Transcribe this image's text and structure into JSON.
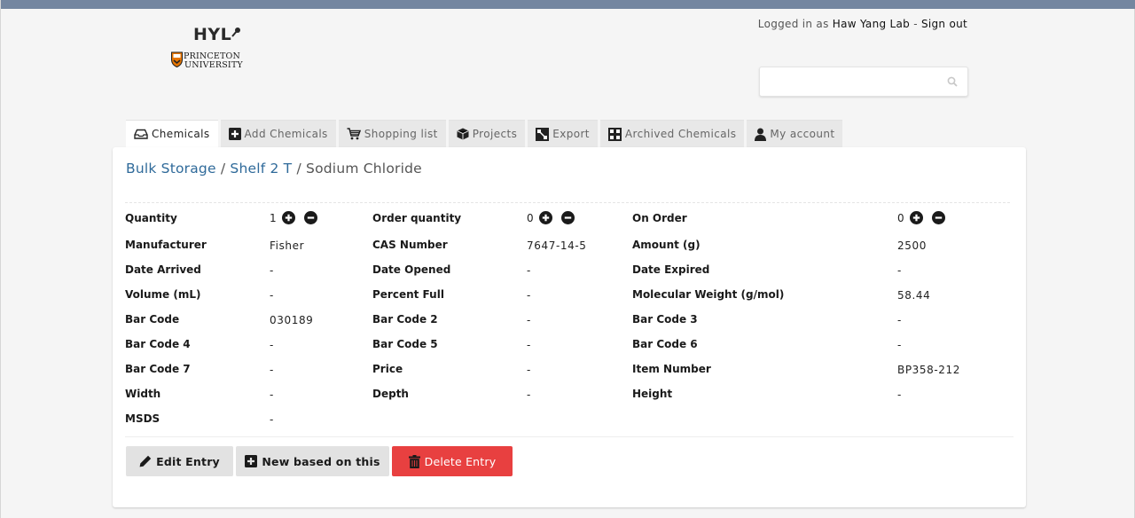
{
  "header": {
    "logo_text": "HYL",
    "institution_line1": "PRINCETON",
    "institution_line2": "UNIVERSITY",
    "logged_in_prefix": "Logged in as ",
    "user_name": "Haw Yang Lab",
    "separator": " - ",
    "sign_out": "Sign out",
    "search_placeholder": ""
  },
  "tabs": [
    {
      "label": "Chemicals",
      "icon": "inbox-icon",
      "active": true
    },
    {
      "label": "Add Chemicals",
      "icon": "plus-square-icon",
      "active": false
    },
    {
      "label": "Shopping list",
      "icon": "cart-icon",
      "active": false
    },
    {
      "label": "Projects",
      "icon": "cube-icon",
      "active": false
    },
    {
      "label": "Export",
      "icon": "export-icon",
      "active": false
    },
    {
      "label": "Archived Chemicals",
      "icon": "sitemap-icon",
      "active": false
    },
    {
      "label": "My account",
      "icon": "user-icon",
      "active": false
    }
  ],
  "breadcrumb": {
    "storage": "Bulk Storage",
    "sep1": " / ",
    "shelf": "Shelf 2 T",
    "sep2": " / ",
    "current": "Sodium Chloride"
  },
  "fields": {
    "col1": [
      {
        "label": "Quantity",
        "value": "1",
        "stepper": true
      },
      {
        "label": "Manufacturer",
        "value": "Fisher"
      },
      {
        "label": "Date Arrived",
        "value": "-"
      },
      {
        "label": "Volume (mL)",
        "value": "-"
      },
      {
        "label": "Bar Code",
        "value": "030189"
      },
      {
        "label": "Bar Code 4",
        "value": "-"
      },
      {
        "label": "Bar Code 7",
        "value": "-"
      },
      {
        "label": "Width",
        "value": "-"
      },
      {
        "label": "MSDS",
        "value": "-"
      }
    ],
    "col2": [
      {
        "label": "Order quantity",
        "value": "0",
        "stepper": true
      },
      {
        "label": "CAS Number",
        "value": "7647-14-5"
      },
      {
        "label": "Date Opened",
        "value": "-"
      },
      {
        "label": "Percent Full",
        "value": "-"
      },
      {
        "label": "Bar Code 2",
        "value": "-"
      },
      {
        "label": "Bar Code 5",
        "value": "-"
      },
      {
        "label": "Price",
        "value": "-"
      },
      {
        "label": "Depth",
        "value": "-"
      }
    ],
    "col3": [
      {
        "label": "On Order",
        "value": "0",
        "stepper": true
      },
      {
        "label": "Amount (g)",
        "value": "2500"
      },
      {
        "label": "Date Expired",
        "value": "-"
      },
      {
        "label": "Molecular Weight (g/mol)",
        "value": "58.44"
      },
      {
        "label": "Bar Code 3",
        "value": "-"
      },
      {
        "label": "Bar Code 6",
        "value": "-"
      },
      {
        "label": "Item Number",
        "value": "BP358-212"
      },
      {
        "label": "Height",
        "value": "-"
      }
    ]
  },
  "actions": {
    "edit": "Edit Entry",
    "new_based": "New based on this",
    "delete": "Delete Entry"
  },
  "colors": {
    "topbar": "#7486a0",
    "link": "#2f6a9a",
    "danger": "#e84040"
  }
}
